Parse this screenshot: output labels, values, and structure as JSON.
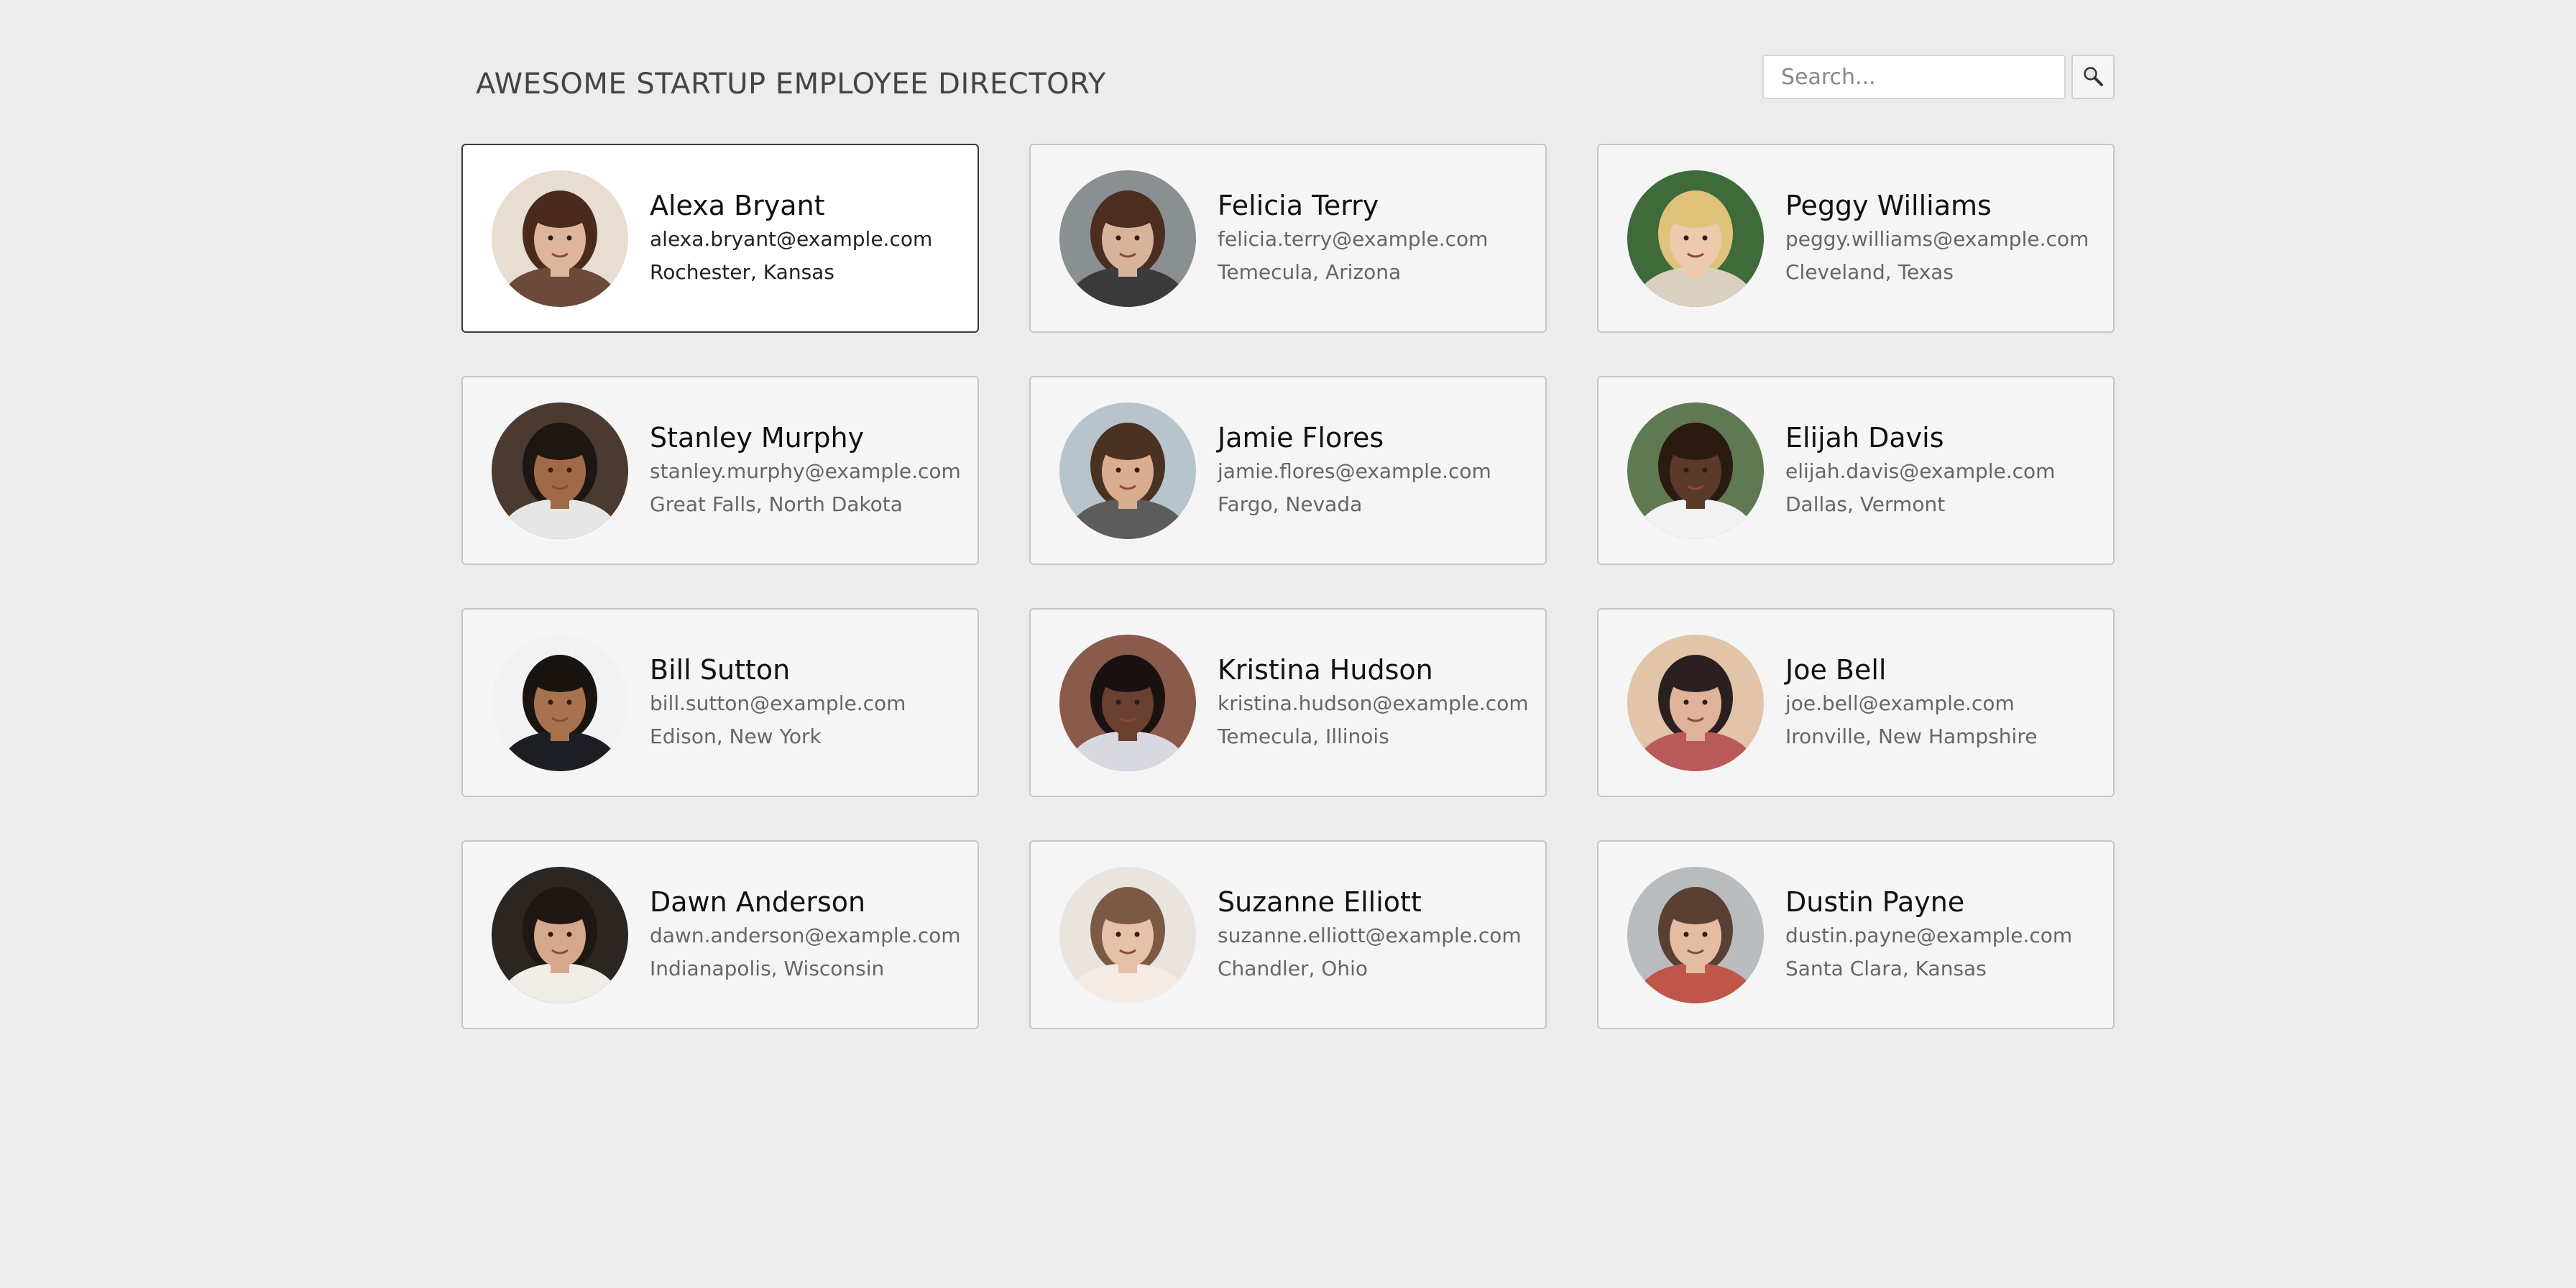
{
  "header": {
    "title": "AWESOME STARTUP EMPLOYEE DIRECTORY"
  },
  "search": {
    "placeholder": "Search...",
    "value": "",
    "button_icon": "magnifier-icon"
  },
  "employees": [
    {
      "name": "Alexa Bryant",
      "email": "alexa.bryant@example.com",
      "location": "Rochester, Kansas",
      "selected": true,
      "photo": {
        "bg": "#e7ddd0",
        "skin": "#dcb59c",
        "hair": "#4a2a1c",
        "shirt": "#6a4a3a"
      }
    },
    {
      "name": "Felicia Terry",
      "email": "felicia.terry@example.com",
      "location": "Temecula, Arizona",
      "photo": {
        "bg": "#8a8f92",
        "skin": "#d8b39c",
        "hair": "#4b2e1f",
        "shirt": "#3b3b3b"
      }
    },
    {
      "name": "Peggy Williams",
      "email": "peggy.williams@example.com",
      "location": "Cleveland, Texas",
      "photo": {
        "bg": "#3f6a3a",
        "skin": "#edc9ae",
        "hair": "#e0c27a",
        "shirt": "#d9d0c0"
      }
    },
    {
      "name": "Stanley Murphy",
      "email": "stanley.murphy@example.com",
      "location": "Great Falls, North Dakota",
      "photo": {
        "bg": "#4a3a30",
        "skin": "#a06a48",
        "hair": "#1e1612",
        "shirt": "#e6e6e6"
      }
    },
    {
      "name": "Jamie Flores",
      "email": "jamie.flores@example.com",
      "location": "Fargo, Nevada",
      "photo": {
        "bg": "#b8c4cc",
        "skin": "#d9ad90",
        "hair": "#4a3222",
        "shirt": "#5c5c5c"
      }
    },
    {
      "name": "Elijah Davis",
      "email": "elijah.davis@example.com",
      "location": "Dallas, Vermont",
      "photo": {
        "bg": "#5f7a52",
        "skin": "#5a3a28",
        "hair": "#2a1a12",
        "shirt": "#f2f2f2"
      }
    },
    {
      "name": "Bill Sutton",
      "email": "bill.sutton@example.com",
      "location": "Edison, New York",
      "photo": {
        "bg": "#f2f2f2",
        "skin": "#a8724e",
        "hair": "#1a1410",
        "shirt": "#1d1d24"
      }
    },
    {
      "name": "Kristina Hudson",
      "email": "kristina.hudson@example.com",
      "location": "Temecula, Illinois",
      "photo": {
        "bg": "#8a5a4a",
        "skin": "#6a4030",
        "hair": "#1a1210",
        "shirt": "#d8d8e0"
      }
    },
    {
      "name": "Joe Bell",
      "email": "joe.bell@example.com",
      "location": "Ironville, New Hampshire",
      "photo": {
        "bg": "#e2c4a8",
        "skin": "#e0b29a",
        "hair": "#2a2020",
        "shirt": "#b85a5a"
      }
    },
    {
      "name": "Dawn Anderson",
      "email": "dawn.anderson@example.com",
      "location": "Indianapolis, Wisconsin",
      "photo": {
        "bg": "#2c2622",
        "skin": "#d6a88a",
        "hair": "#1e1814",
        "shirt": "#f0ece6"
      }
    },
    {
      "name": "Suzanne Elliott",
      "email": "suzanne.elliott@example.com",
      "location": "Chandler, Ohio",
      "photo": {
        "bg": "#eae4de",
        "skin": "#e6c0a8",
        "hair": "#7a5a44",
        "shirt": "#f4ece4"
      }
    },
    {
      "name": "Dustin Payne",
      "email": "dustin.payne@example.com",
      "location": "Santa Clara, Kansas",
      "photo": {
        "bg": "#b9bcbe",
        "skin": "#e4bca4",
        "hair": "#5a4032",
        "shirt": "#c0564a"
      }
    }
  ]
}
